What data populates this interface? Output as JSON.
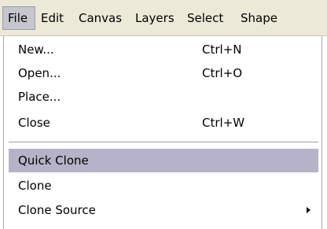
{
  "menubar": {
    "items": [
      {
        "label": "File"
      },
      {
        "label": "Edit"
      },
      {
        "label": "Canvas"
      },
      {
        "label": "Layers"
      },
      {
        "label": "Select"
      },
      {
        "label": "Shape"
      }
    ]
  },
  "file_menu": {
    "group1": [
      {
        "label": "New...",
        "shortcut": "Ctrl+N"
      },
      {
        "label": "Open...",
        "shortcut": "Ctrl+O"
      },
      {
        "label": "Place...",
        "shortcut": ""
      },
      {
        "label": "Close",
        "shortcut": "Ctrl+W"
      }
    ],
    "group2": [
      {
        "label": "Quick Clone",
        "highlighted": true
      },
      {
        "label": "Clone"
      },
      {
        "label": "Clone Source",
        "has_submenu": true,
        "submenu_icon": "triangle-right-icon"
      }
    ]
  },
  "colors": {
    "menubar_bg": "#ece9d8",
    "highlight": "#b4b3c8",
    "active_menu": "#c6c6cf"
  }
}
